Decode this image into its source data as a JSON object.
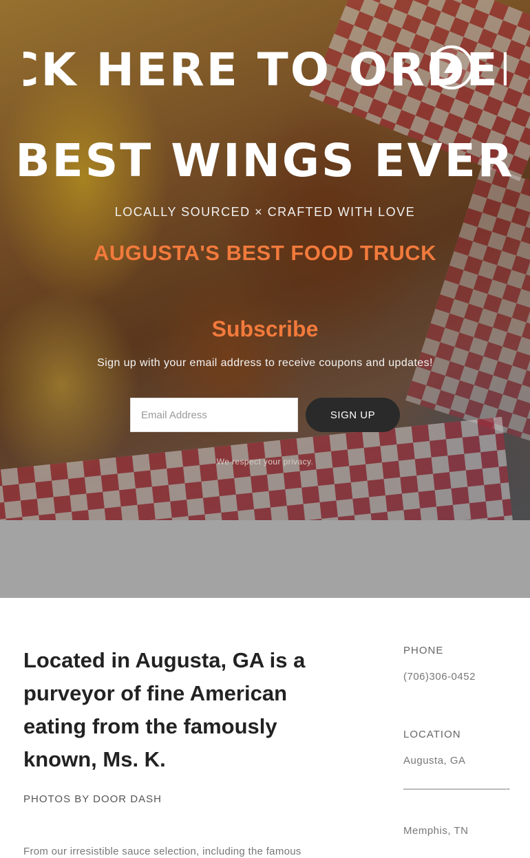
{
  "hero": {
    "marquee_text": "CLICK HERE TO ORDER CLICK HERE TO ORDER",
    "order_icon": "circle-play-icon",
    "headline": "BEST WINGS EVER",
    "tagline": "LOCALLY SOURCED × CRAFTED WITH LOVE",
    "truck_title": "AUGUSTA'S BEST FOOD TRUCK"
  },
  "subscribe": {
    "title": "Subscribe",
    "description": "Sign up with your email address to receive coupons and updates!",
    "email_placeholder": "Email Address",
    "email_value": "",
    "button_label": "SIGN UP",
    "privacy_note": "We respect your privacy."
  },
  "about": {
    "heading": "Located in Augusta, GA is a purveyor of fine American eating from the famously known, Ms. K.",
    "photo_credit": "PHOTOS BY DOOR DASH",
    "body": "From our irresistible sauce selection, including the famous"
  },
  "contact": {
    "phone_label": "PHONE",
    "phone_value": "(706)306-0452",
    "location_label": "LOCATION",
    "location_1": "Augusta, GA",
    "divider": "——————————-",
    "location_2": "Memphis, TN"
  },
  "colors": {
    "accent": "#f27a3c",
    "button_dark": "#2a2a2a",
    "band_gray": "#a3a3a3"
  }
}
